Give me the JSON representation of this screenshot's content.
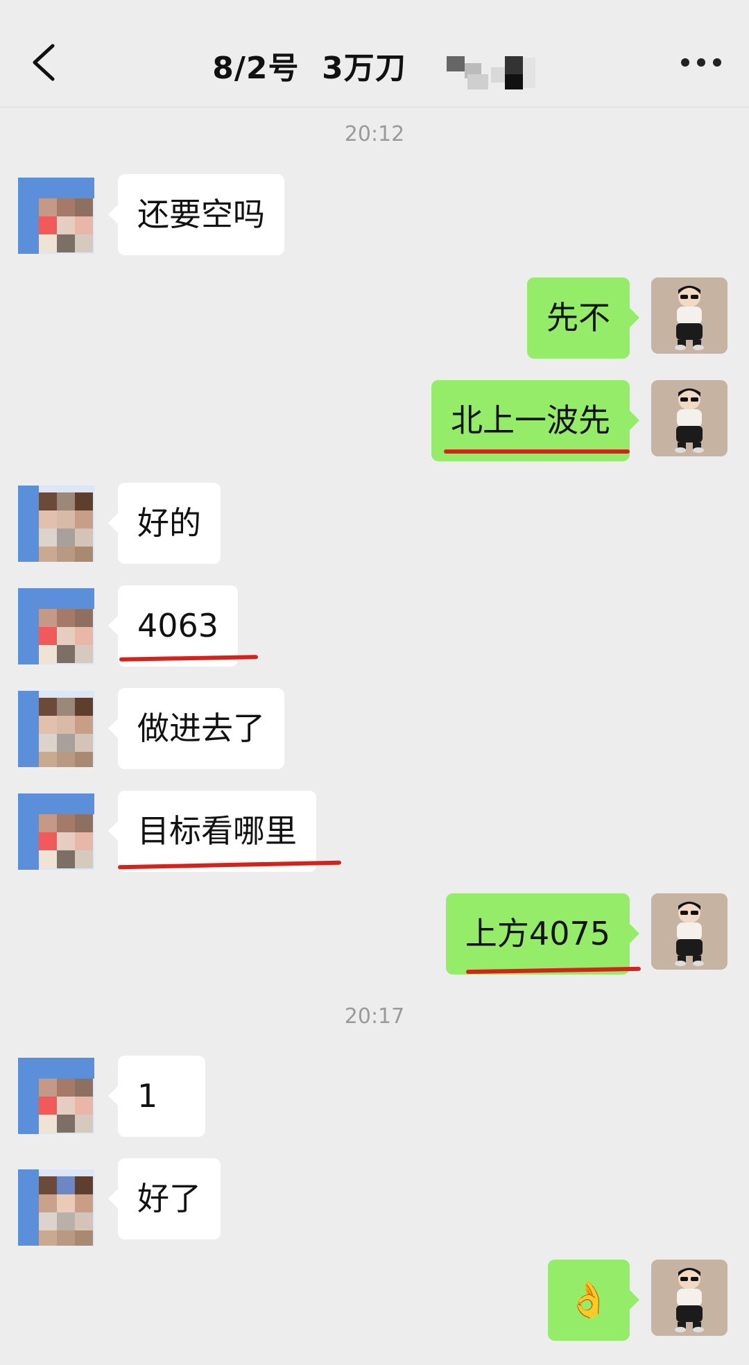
{
  "header": {
    "title": "8/2号  3万刀",
    "back_icon": "chevron-left-icon",
    "more_icon": "more-horizontal-icon"
  },
  "messages": [
    {
      "type": "time",
      "text": "20:12"
    },
    {
      "type": "in",
      "text": "还要空吗"
    },
    {
      "type": "out",
      "text": "先不"
    },
    {
      "type": "out",
      "text": "北上一波先",
      "underlined": true
    },
    {
      "type": "in",
      "text": "好的"
    },
    {
      "type": "in",
      "text": "4063",
      "underlined": true
    },
    {
      "type": "in",
      "text": "做进去了"
    },
    {
      "type": "in",
      "text": "目标看哪里",
      "underlined": true
    },
    {
      "type": "out",
      "text": "上方4075",
      "underlined": true
    },
    {
      "type": "time",
      "text": "20:17"
    },
    {
      "type": "in",
      "text": "1"
    },
    {
      "type": "in",
      "text": "好了"
    },
    {
      "type": "out",
      "text": "👌",
      "emoji": "ok-hand"
    }
  ],
  "colors": {
    "background": "#ededed",
    "incoming_bubble": "#ffffff",
    "outgoing_bubble": "#95ec69",
    "annotation_underline": "#d5221b",
    "timestamp": "#9a9a9a"
  }
}
